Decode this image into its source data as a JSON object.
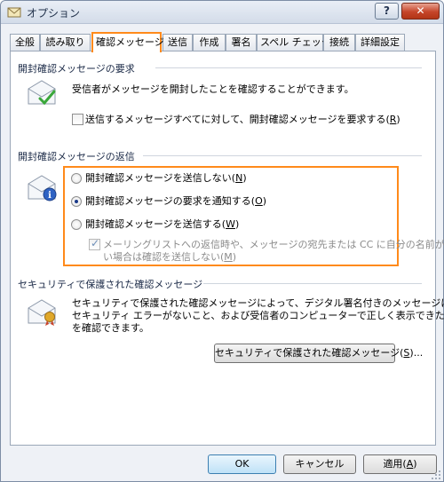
{
  "window": {
    "title": "オプション",
    "help_button": "?",
    "close_button": "✕"
  },
  "tabs": [
    {
      "label": "全般"
    },
    {
      "label": "読み取り"
    },
    {
      "label": "確認メッセージ"
    },
    {
      "label": "送信"
    },
    {
      "label": "作成"
    },
    {
      "label": "署名"
    },
    {
      "label": "スペル チェック"
    },
    {
      "label": "接続"
    },
    {
      "label": "詳細設定"
    }
  ],
  "request_section": {
    "title": "開封確認メッセージの要求",
    "description": "受信者がメッセージを開封したことを確認することができます。",
    "checkbox_label": "送信するメッセージすべてに対して、開封確認メッセージを要求する(",
    "checkbox_key": "R",
    "checkbox_checked": false
  },
  "return_section": {
    "title": "開封確認メッセージの返信",
    "options": [
      {
        "label": "開封確認メッセージを送信しない(",
        "key": "N",
        "selected": false
      },
      {
        "label": "開封確認メッセージの要求を通知する(",
        "key": "O",
        "selected": true
      },
      {
        "label": "開封確認メッセージを送信する(",
        "key": "W",
        "selected": false
      }
    ],
    "mailing_list_line1": "メーリングリストへの返信時や、メッセージの宛先または CC に自分の名前がな",
    "mailing_list_line2": "い場合は確認を送信しない(",
    "mailing_list_key": "M",
    "mailing_list_checked": true,
    "mailing_list_enabled": false
  },
  "secure_section": {
    "title": "セキュリティで保護された確認メッセージ",
    "line1": "セキュリティで保護された確認メッセージによって、デジタル署名付きのメッセージに",
    "line2": "セキュリティ エラーがないこと、および受信者のコンピューターで正しく表示できたこと",
    "line3": "を確認できます。",
    "button_label": "セキュリティで保護された確認メッセージ(",
    "button_key": "S",
    "button_suffix": ")..."
  },
  "footer": {
    "ok": "OK",
    "cancel": "キャンセル",
    "apply": "適用(",
    "apply_key": "A",
    "close_paren": ")"
  },
  "colors": {
    "highlight": "#ff8a1a",
    "accent": "#1b3a8a"
  }
}
